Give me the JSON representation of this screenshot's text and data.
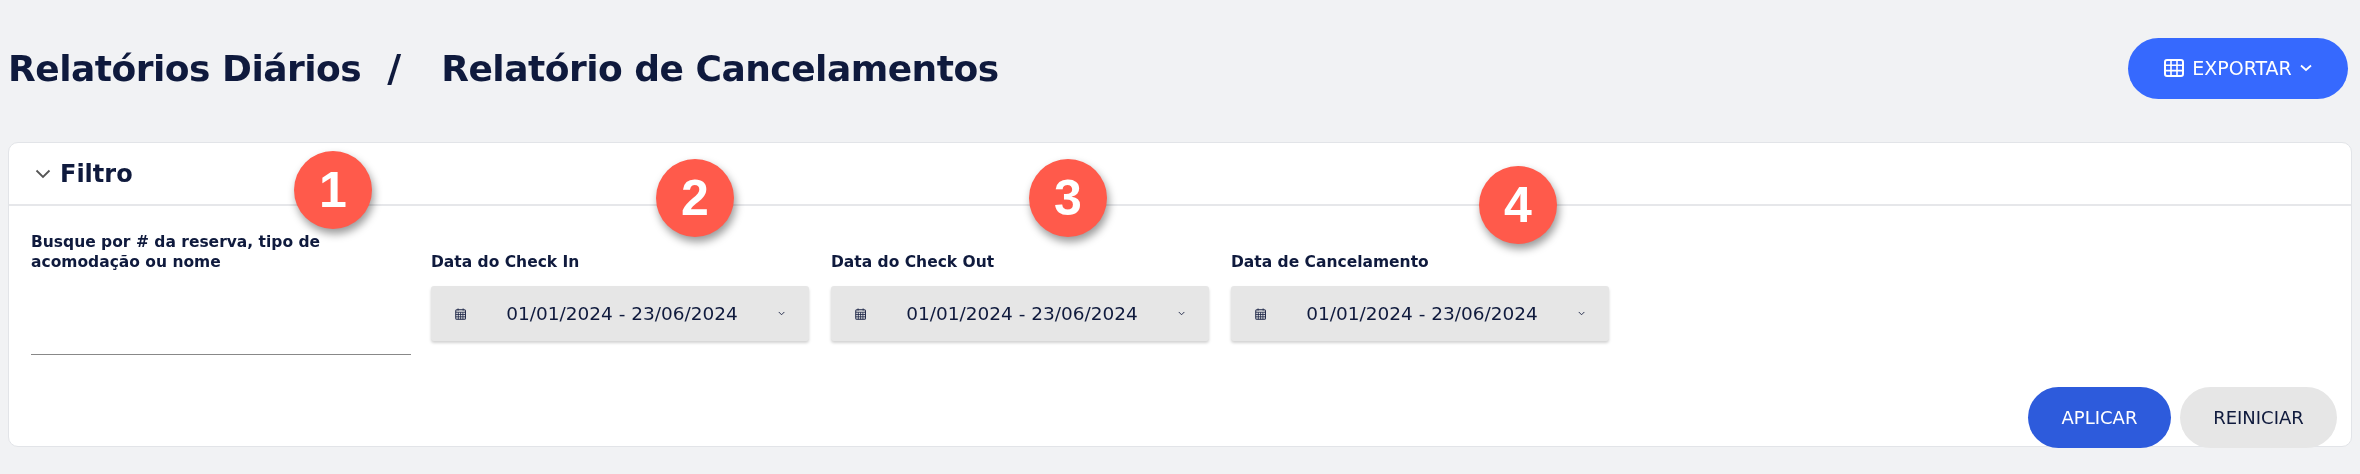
{
  "breadcrumb": [
    {
      "label": "Relatórios Diários"
    },
    {
      "label": "Relatório de Cancelamentos"
    }
  ],
  "breadcrumb_separator": "/",
  "export_button": {
    "label": "EXPORTAR"
  },
  "filter": {
    "title": "Filtro",
    "expanded": true,
    "search": {
      "label": "Busque por # da reserva, tipo de acomodação ou nome"
    },
    "date_fields": [
      {
        "label": "Data do Check In",
        "value": "01/01/2024 - 23/06/2024"
      },
      {
        "label": "Data do Check Out",
        "value": "01/01/2024 - 23/06/2024"
      },
      {
        "label": "Data de Cancelamento",
        "value": "01/01/2024 - 23/06/2024"
      }
    ],
    "buttons": [
      {
        "label": "APLICAR",
        "kind": "primary"
      },
      {
        "label": "REINICIAR",
        "kind": "secondary"
      }
    ]
  },
  "callouts": [
    {
      "number": "1"
    },
    {
      "number": "2"
    },
    {
      "number": "3"
    },
    {
      "number": "4"
    }
  ]
}
